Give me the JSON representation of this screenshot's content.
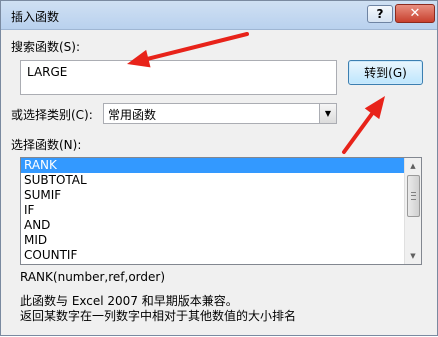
{
  "dialog": {
    "title": "插入函数",
    "help_label": "?",
    "close_label": "✕"
  },
  "search": {
    "label": "搜索函数(S):",
    "value": "LARGE",
    "go_button": "转到(G)"
  },
  "category": {
    "label": "或选择类别(C):",
    "selected": "常用函数"
  },
  "functions": {
    "label": "选择函数(N):",
    "items": [
      "RANK",
      "SUBTOTAL",
      "SUMIF",
      "IF",
      "AND",
      "MID",
      "COUNTIF"
    ],
    "selected_index": 0
  },
  "details": {
    "signature": "RANK(number,ref,order)",
    "compat": "此函数与 Excel 2007 和早期版本兼容。",
    "description": "返回某数字在一列数字中相对于其他数值的大小排名"
  },
  "annotation": {
    "arrow_color": "#e8231a"
  }
}
